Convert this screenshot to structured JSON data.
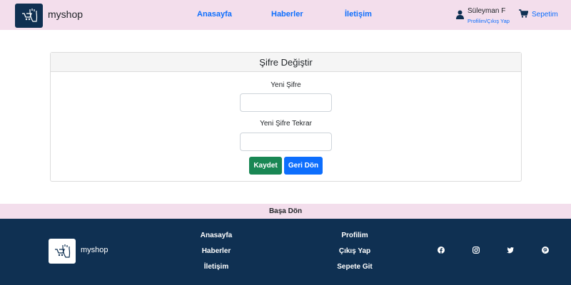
{
  "header": {
    "brand": "myshop",
    "nav": [
      "Anasayfa",
      "Haberler",
      "İletişim"
    ],
    "user_name": "Süleyman F",
    "user_links": "Profilim/Çıkış Yap",
    "cart_label": "Sepetim",
    "icons": {
      "logo": "hand-cart-logo-icon",
      "user": "user-icon",
      "cart": "cart-icon"
    }
  },
  "card": {
    "title": "Şifre Değiştir",
    "new_password_label": "Yeni Şifre",
    "new_password_value": "",
    "repeat_password_label": "Yeni Şifre Tekrar",
    "repeat_password_value": "",
    "save_label": "Kaydet",
    "back_label": "Geri Dön"
  },
  "back_to_top": "Başa Dön",
  "footer": {
    "brand": "myshop",
    "col1": [
      "Anasayfa",
      "Haberler",
      "İletişim"
    ],
    "col2": [
      "Profilim",
      "Çıkış Yap",
      "Sepete Git"
    ],
    "social": [
      "facebook-icon",
      "instagram-icon",
      "twitter-icon",
      "pinterest-icon"
    ]
  },
  "colors": {
    "header_bg": "#f3deec",
    "footer_bg": "#0f3052",
    "link": "#0d6efd",
    "success": "#198754",
    "primary": "#0d6efd"
  }
}
